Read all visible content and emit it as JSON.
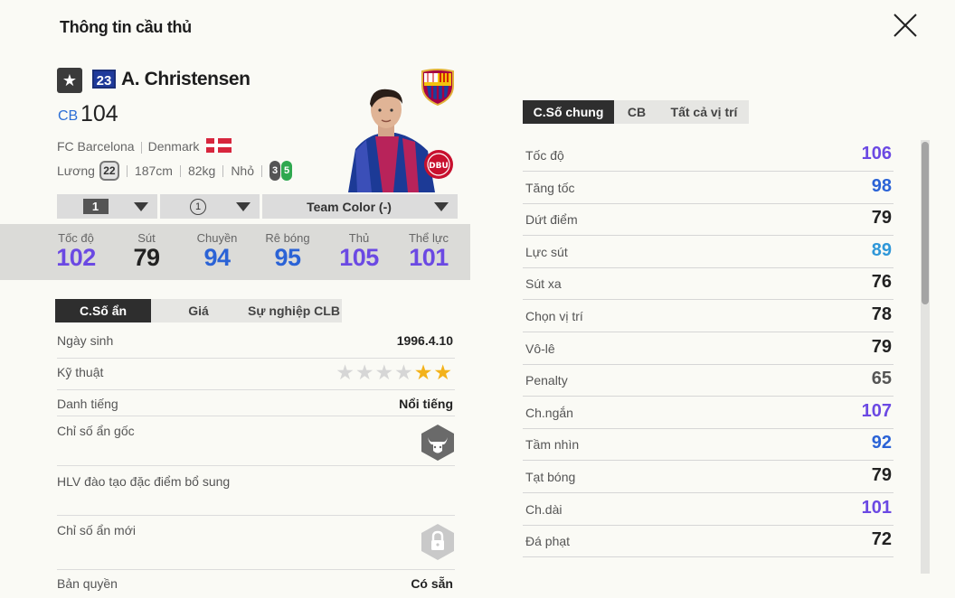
{
  "window": {
    "title": "Thông tin cầu thủ"
  },
  "player": {
    "number": "23",
    "name": "A. Christensen",
    "position": "CB",
    "ovr": "104",
    "club": "FC Barcelona",
    "nation": "Denmark",
    "salary_label": "Lương",
    "salary": "22",
    "height": "187cm",
    "weight": "82kg",
    "body": "Nhỏ",
    "weak_foot": "3",
    "strong_foot": "5"
  },
  "selectors": {
    "level": "1",
    "upgrade": "1",
    "team_color": "Team Color (-)"
  },
  "main_stats": [
    {
      "label": "Tốc độ",
      "value": "102",
      "color": "#6b49e3"
    },
    {
      "label": "Sút",
      "value": "79",
      "color": "#222222"
    },
    {
      "label": "Chuyền",
      "value": "94",
      "color": "#2b63d6"
    },
    {
      "label": "Rê bóng",
      "value": "95",
      "color": "#2b63d6"
    },
    {
      "label": "Thủ",
      "value": "105",
      "color": "#6b49e3"
    },
    {
      "label": "Thể lực",
      "value": "101",
      "color": "#6b49e3"
    }
  ],
  "left_tabs": [
    "C.Số ẩn",
    "Giá",
    "Sự nghiệp CLB"
  ],
  "hidden": {
    "birth_label": "Ngày sinh",
    "birth": "1996.4.10",
    "skill_label": "Kỹ thuật",
    "skill_stars": 2,
    "skill_total": 6,
    "fame_label": "Danh tiếng",
    "fame": "Nổi tiếng",
    "origin_label": "Chỉ số ẩn gốc",
    "origin_icon": "bull-icon",
    "coach_label": "HLV đào tạo đặc điểm bổ sung",
    "new_label": "Chỉ số ẩn mới",
    "new_icon": "lock-icon",
    "rights_label": "Bản quyền",
    "rights": "Có sẵn"
  },
  "right_tabs": [
    "C.Số chung",
    "CB",
    "Tất cả vị trí"
  ],
  "detail_stats": [
    {
      "label": "Tốc độ",
      "value": "106",
      "color": "#6b49e3"
    },
    {
      "label": "Tăng tốc",
      "value": "98",
      "color": "#2b63d6"
    },
    {
      "label": "Dứt điểm",
      "value": "79",
      "color": "#222222"
    },
    {
      "label": "Lực sút",
      "value": "89",
      "color": "#2f97d8"
    },
    {
      "label": "Sút xa",
      "value": "76",
      "color": "#222222"
    },
    {
      "label": "Chọn vị trí",
      "value": "78",
      "color": "#222222"
    },
    {
      "label": "Vô-lê",
      "value": "79",
      "color": "#222222"
    },
    {
      "label": "Penalty",
      "value": "65",
      "color": "#555555"
    },
    {
      "label": "Ch.ngắn",
      "value": "107",
      "color": "#6b49e3"
    },
    {
      "label": "Tầm nhìn",
      "value": "92",
      "color": "#2b63d6"
    },
    {
      "label": "Tạt bóng",
      "value": "79",
      "color": "#222222"
    },
    {
      "label": "Ch.dài",
      "value": "101",
      "color": "#6b49e3"
    },
    {
      "label": "Đá phạt",
      "value": "72",
      "color": "#222222"
    }
  ]
}
